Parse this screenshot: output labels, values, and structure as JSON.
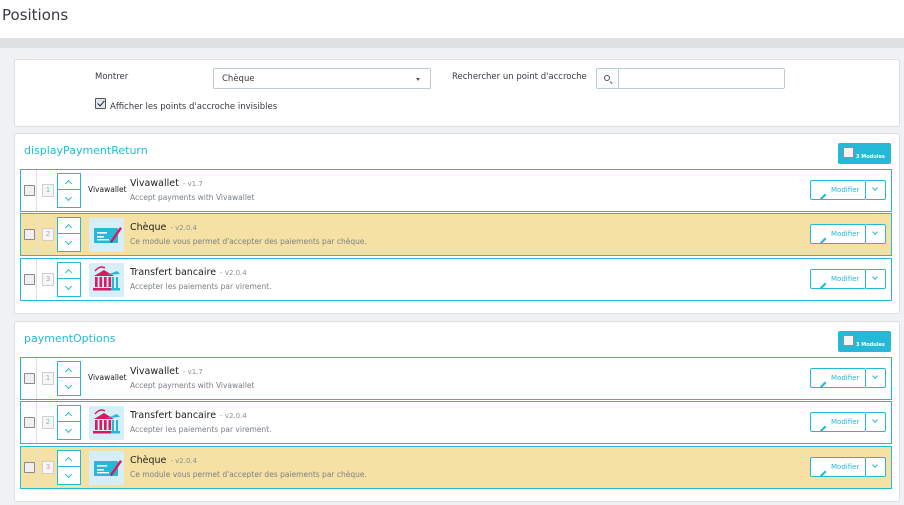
{
  "page": {
    "title": "Positions"
  },
  "filter": {
    "show_label": "Montrer",
    "show_value": "Chèque",
    "search_label": "Rechercher un point d'accroche",
    "search_value": "",
    "invisible_label": "Afficher les points d'accroche invisibles",
    "invisible_checked": true
  },
  "hooks": [
    {
      "name": "displayPaymentReturn",
      "count_label": "3 Modules",
      "modules": [
        {
          "position": "1",
          "logo_text": "Vivawallet",
          "name": "Vivawallet",
          "version": "- v1.7",
          "description": "Accept payments with Vivawallet",
          "highlighted": false,
          "logo_icon": "text-logo"
        },
        {
          "position": "2",
          "logo_text": "",
          "name": "Chèque",
          "version": "- v2.0.4",
          "description": "Ce module vous permet d'accepter des paiements par chèque.",
          "highlighted": true,
          "logo_icon": "cheque-icon"
        },
        {
          "position": "3",
          "logo_text": "",
          "name": "Transfert bancaire",
          "version": "- v2.0.4",
          "description": "Accepter les paiements par virement.",
          "highlighted": false,
          "logo_icon": "bank-icon"
        }
      ]
    },
    {
      "name": "paymentOptions",
      "count_label": "3 Modules",
      "modules": [
        {
          "position": "1",
          "logo_text": "Vivawallet",
          "name": "Vivawallet",
          "version": "- v1.7",
          "description": "Accept payments with Vivawallet",
          "highlighted": false,
          "logo_icon": "text-logo"
        },
        {
          "position": "2",
          "logo_text": "",
          "name": "Transfert bancaire",
          "version": "- v2.0.4",
          "description": "Accepter les paiements par virement.",
          "highlighted": false,
          "logo_icon": "bank-icon"
        },
        {
          "position": "3",
          "logo_text": "",
          "name": "Chèque",
          "version": "- v2.0.4",
          "description": "Ce module vous permet d'accepter des paiements par chèque.",
          "highlighted": true,
          "logo_icon": "cheque-icon"
        }
      ]
    }
  ],
  "actions": {
    "edit_label": "Modifier"
  },
  "colors": {
    "accent": "#25b9d7",
    "highlight": "#f5e1a4",
    "page_bg": "#eff1f2"
  }
}
